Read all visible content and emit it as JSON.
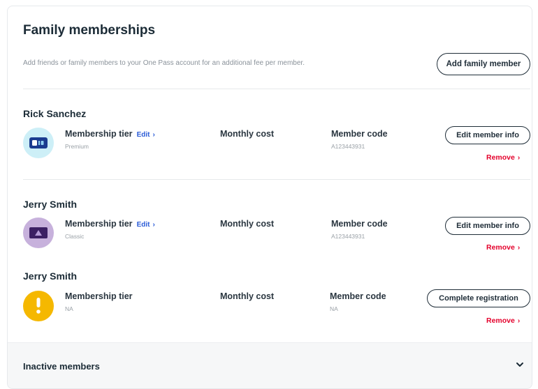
{
  "header": {
    "title": "Family memberships",
    "subtitle": "Add friends or family members to your One Pass account for an additional fee per member.",
    "add_button": "Add family member"
  },
  "columns": {
    "tier": "Membership tier",
    "cost": "Monthly cost",
    "code": "Member code"
  },
  "members": [
    {
      "name": "Rick Sanchez",
      "tier": "Premium",
      "code": "A123443931",
      "edit_label": "Edit",
      "action_button": "Edit member info",
      "remove_label": "Remove",
      "icon": "blue-card-icon",
      "avatar_color": "#cdeff7"
    },
    {
      "name": "Jerry Smith",
      "tier": "Classic",
      "code": "A123443931",
      "edit_label": "Edit",
      "action_button": "Edit member info",
      "remove_label": "Remove",
      "icon": "purple-card-icon",
      "avatar_color": "#c7b1dc"
    },
    {
      "name": "Jerry Smith",
      "tier": "NA",
      "code": "NA",
      "action_button": "Complete registration",
      "remove_label": "Remove",
      "icon": "warning-icon",
      "avatar_color": "#f5b800"
    }
  ],
  "inactive": {
    "label": "Inactive members"
  },
  "colors": {
    "link_blue": "#2a5bd7",
    "remove_red": "#e4002b",
    "text_dark": "#1b2b36"
  }
}
